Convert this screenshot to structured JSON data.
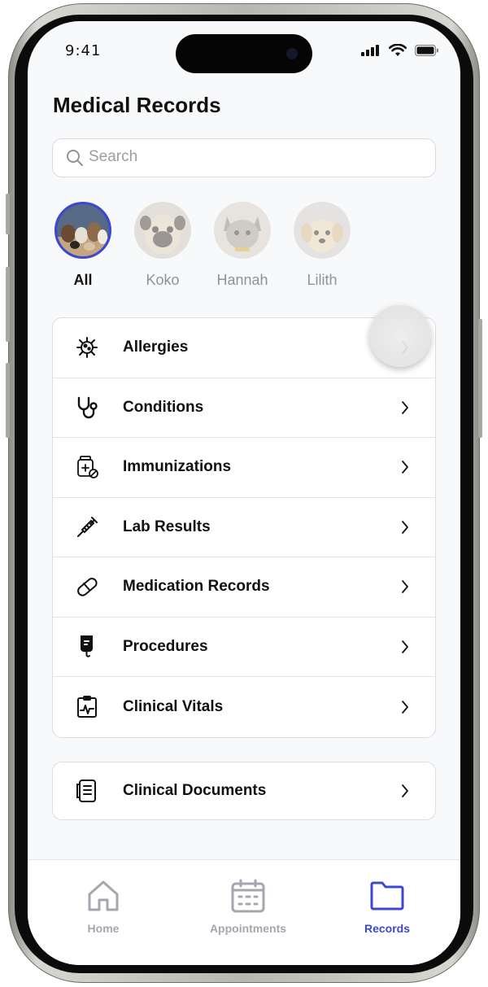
{
  "status_bar": {
    "time": "9:41"
  },
  "header": {
    "title": "Medical Records"
  },
  "search": {
    "placeholder": "Search",
    "value": ""
  },
  "pets": [
    {
      "name": "All",
      "selected": true
    },
    {
      "name": "Koko",
      "selected": false
    },
    {
      "name": "Hannah",
      "selected": false
    },
    {
      "name": "Lilith",
      "selected": false
    }
  ],
  "records": [
    {
      "label": "Allergies",
      "icon": "virus-icon"
    },
    {
      "label": "Conditions",
      "icon": "stethoscope-icon"
    },
    {
      "label": "Immunizations",
      "icon": "medicine-jar-icon"
    },
    {
      "label": "Lab Results",
      "icon": "syringe-icon"
    },
    {
      "label": "Medication Records",
      "icon": "pill-icon"
    },
    {
      "label": "Procedures",
      "icon": "iv-bag-icon"
    },
    {
      "label": "Clinical Vitals",
      "icon": "vitals-clipboard-icon"
    }
  ],
  "documents": {
    "label": "Clinical Documents",
    "icon": "document-icon"
  },
  "tabbar": [
    {
      "label": "Home",
      "icon": "home-icon",
      "active": false
    },
    {
      "label": "Appointments",
      "icon": "calendar-icon",
      "active": false
    },
    {
      "label": "Records",
      "icon": "folder-icon",
      "active": true
    }
  ],
  "colors": {
    "accent": "#3c47d6",
    "text": "#111111",
    "muted": "#8f9297",
    "border": "#dcdee2",
    "background": "#f8f9fb"
  }
}
